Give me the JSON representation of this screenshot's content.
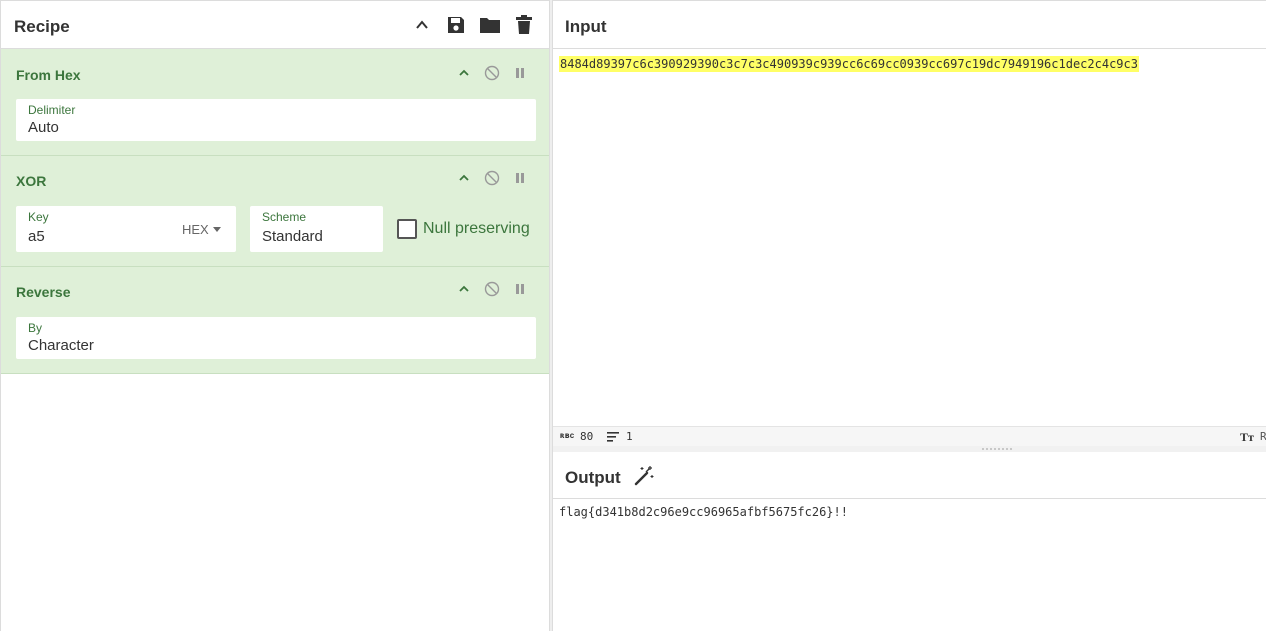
{
  "recipe": {
    "title": "Recipe",
    "header_icons": [
      "chevron-up-icon",
      "save-icon",
      "folder-icon",
      "trash-icon"
    ],
    "operations": [
      {
        "name": "From Hex",
        "fields": [
          {
            "label": "Delimiter",
            "value": "Auto"
          }
        ]
      },
      {
        "name": "XOR",
        "key": {
          "label": "Key",
          "value": "a5",
          "format": "HEX"
        },
        "scheme": {
          "label": "Scheme",
          "value": "Standard"
        },
        "null_preserving": {
          "label": "Null preserving",
          "checked": false
        }
      },
      {
        "name": "Reverse",
        "fields": [
          {
            "label": "By",
            "value": "Character"
          }
        ]
      }
    ]
  },
  "input": {
    "title": "Input",
    "text": "8484d89397c6c390929390c3c7c3c490939c939cc6c69cc0939cc697c19dc7949196c1dec2c4c9c3",
    "status": {
      "length": "80",
      "lines": "1"
    }
  },
  "output": {
    "title": "Output",
    "text": "flag{d341b8d2c96e9cc96965afbf5675fc26}!!"
  },
  "colors": {
    "op_bg": "#dff0d8",
    "op_text": "#3c763d",
    "highlight": "#ffff66"
  }
}
